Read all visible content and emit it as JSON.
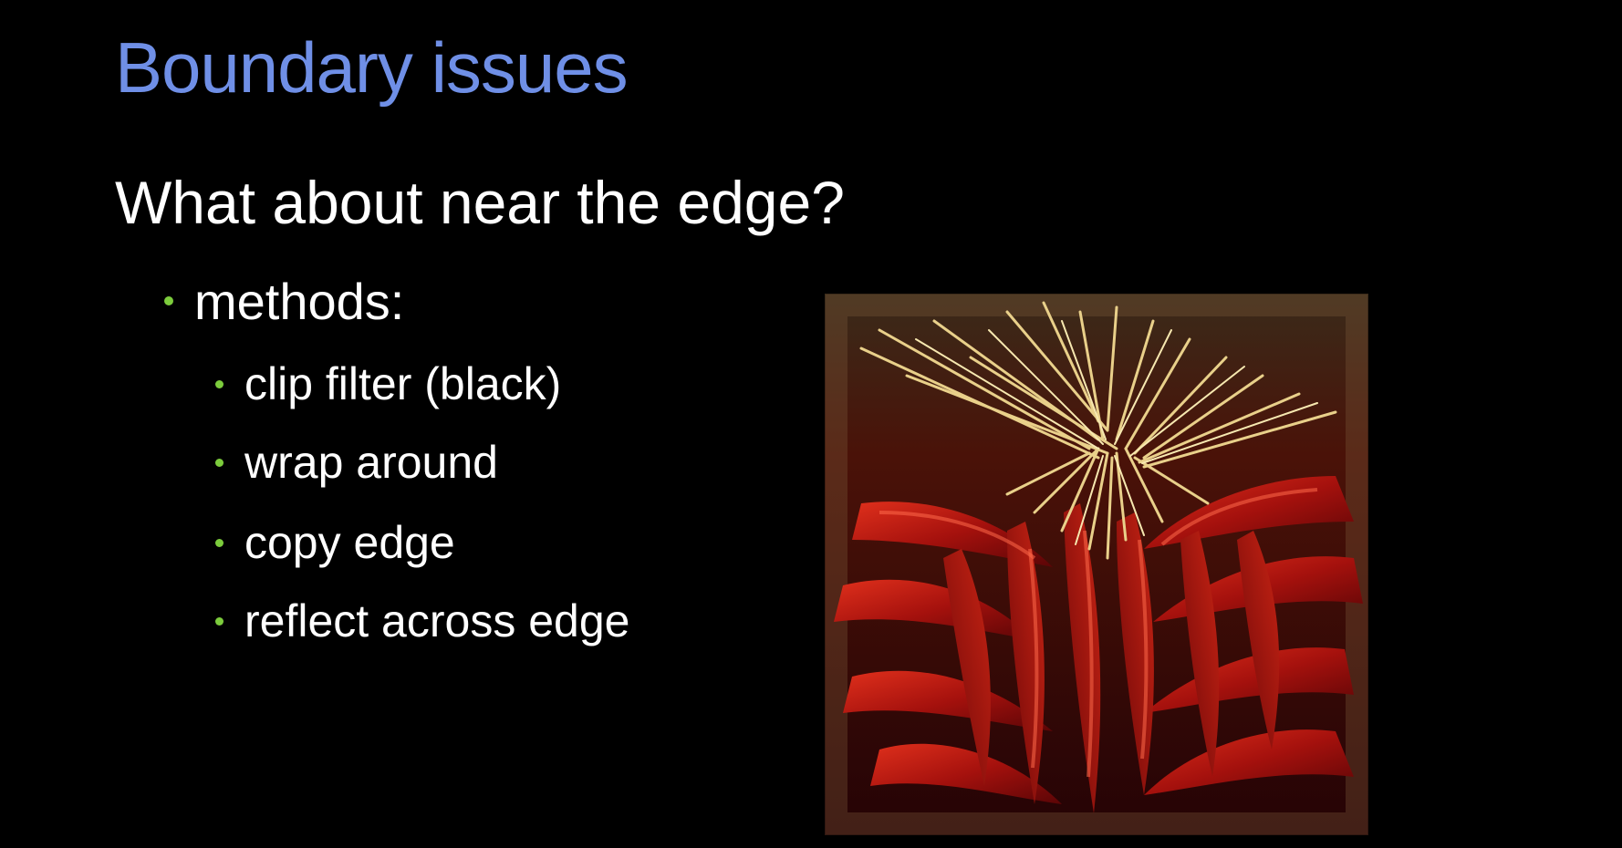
{
  "slide": {
    "title": "Boundary issues",
    "heading": "What about near the edge?",
    "bullet": "methods:",
    "sub_bullets": [
      "clip filter (black)",
      "wrap around",
      "copy edge",
      "reflect across edge"
    ]
  },
  "colors": {
    "background": "#000000",
    "title": "#6f8fe6",
    "text": "#ffffff",
    "bullet": "#7ccc3c"
  },
  "image": {
    "subject": "red chili peppers hanging from a straw bundle, with reflected border"
  }
}
